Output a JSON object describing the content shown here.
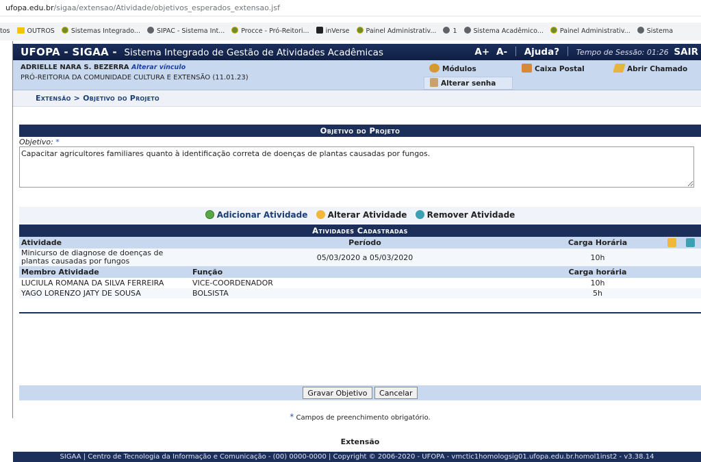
{
  "browser": {
    "url_host": "ufopa.edu.br",
    "url_path": "/sigaa/extensao/Atividade/objetivos_esperados_extensao.jsf",
    "bookmarks": [
      {
        "label": "tos",
        "icon": "none"
      },
      {
        "label": "OUTROS",
        "icon": "folder-icon"
      },
      {
        "label": "Sistemas Integrado...",
        "icon": "ufopa-icon"
      },
      {
        "label": "SIPAC - Sistema Int...",
        "icon": "globe-icon"
      },
      {
        "label": "Procce - Pró-Reitori...",
        "icon": "ufopa-icon"
      },
      {
        "label": "inVerse",
        "icon": "inverse-icon"
      },
      {
        "label": "Painel Administrativ...",
        "icon": "ufopa-icon"
      },
      {
        "label": "1",
        "icon": "globe-icon"
      },
      {
        "label": "Sistema Acadêmico...",
        "icon": "globe-icon"
      },
      {
        "label": "Painel Administrativ...",
        "icon": "ufopa-icon"
      },
      {
        "label": "Sistema",
        "icon": "globe-icon"
      }
    ]
  },
  "header": {
    "brand": "UFOPA - SIGAA -",
    "subtitle": "Sistema Integrado de Gestão de Atividades Acadêmicas",
    "font_plus": "A+",
    "font_minus": "A-",
    "help": "Ajuda?",
    "session": "Tempo de Sessão: 01:26",
    "logout": "SAIR"
  },
  "user": {
    "name": "ADRIELLE NARA S. BEZERRA",
    "change_link": "Alterar vínculo",
    "department": "PRÓ-REITORIA DA COMUNIDADE CULTURA E EXTENSÃO (11.01.23)",
    "modulos": "Módulos",
    "caixa_postal": "Caixa Postal",
    "abrir_chamado": "Abrir Chamado",
    "alterar_senha": "Alterar senha"
  },
  "breadcrumb": {
    "text": "Extensão > Objetivo do Projeto"
  },
  "objetivo": {
    "section_title": "Objetivo do Projeto",
    "label": "Objetivo:",
    "required_star": "*",
    "value": "Capacitar agricultores familiares quanto à identificação correta de doenças de plantas causadas por fungos."
  },
  "actions": {
    "add": "Adicionar Atividade",
    "edit": "Alterar Atividade",
    "remove": "Remover Atividade"
  },
  "atividades": {
    "section_title": "Atividades Cadastradas",
    "headers": {
      "atividade": "Atividade",
      "periodo": "Período",
      "carga": "Carga Horária"
    },
    "row": {
      "atividade": "Minicurso de diagnose de doenças de plantas causadas por fungos",
      "periodo": "05/03/2020 a 05/03/2020",
      "carga": "10h"
    },
    "member_headers": {
      "membro": "Membro Atividade",
      "funcao": "Função",
      "carga": "Carga horária"
    },
    "members": [
      {
        "nome": "LUCIULA ROMANA DA SILVA FERREIRA",
        "funcao": "VICE-COORDENADOR",
        "carga": "10h"
      },
      {
        "nome": "YAGO LORENZO JATY DE SOUSA",
        "funcao": "BOLSISTA",
        "carga": "5h"
      }
    ]
  },
  "form": {
    "save": "Gravar Objetivo",
    "cancel": "Cancelar",
    "required_star": "*",
    "required_note": "Campos de preenchimento obrigatório."
  },
  "footer": {
    "title": "Extensão",
    "text": "SIGAA | Centro de Tecnologia da Informação e Comunicação - (00) 0000-0000 | Copyright © 2006-2020 - UFOPA - vmctic1homologsig01.ufopa.edu.br.homol1inst2 - v3.38.14"
  }
}
